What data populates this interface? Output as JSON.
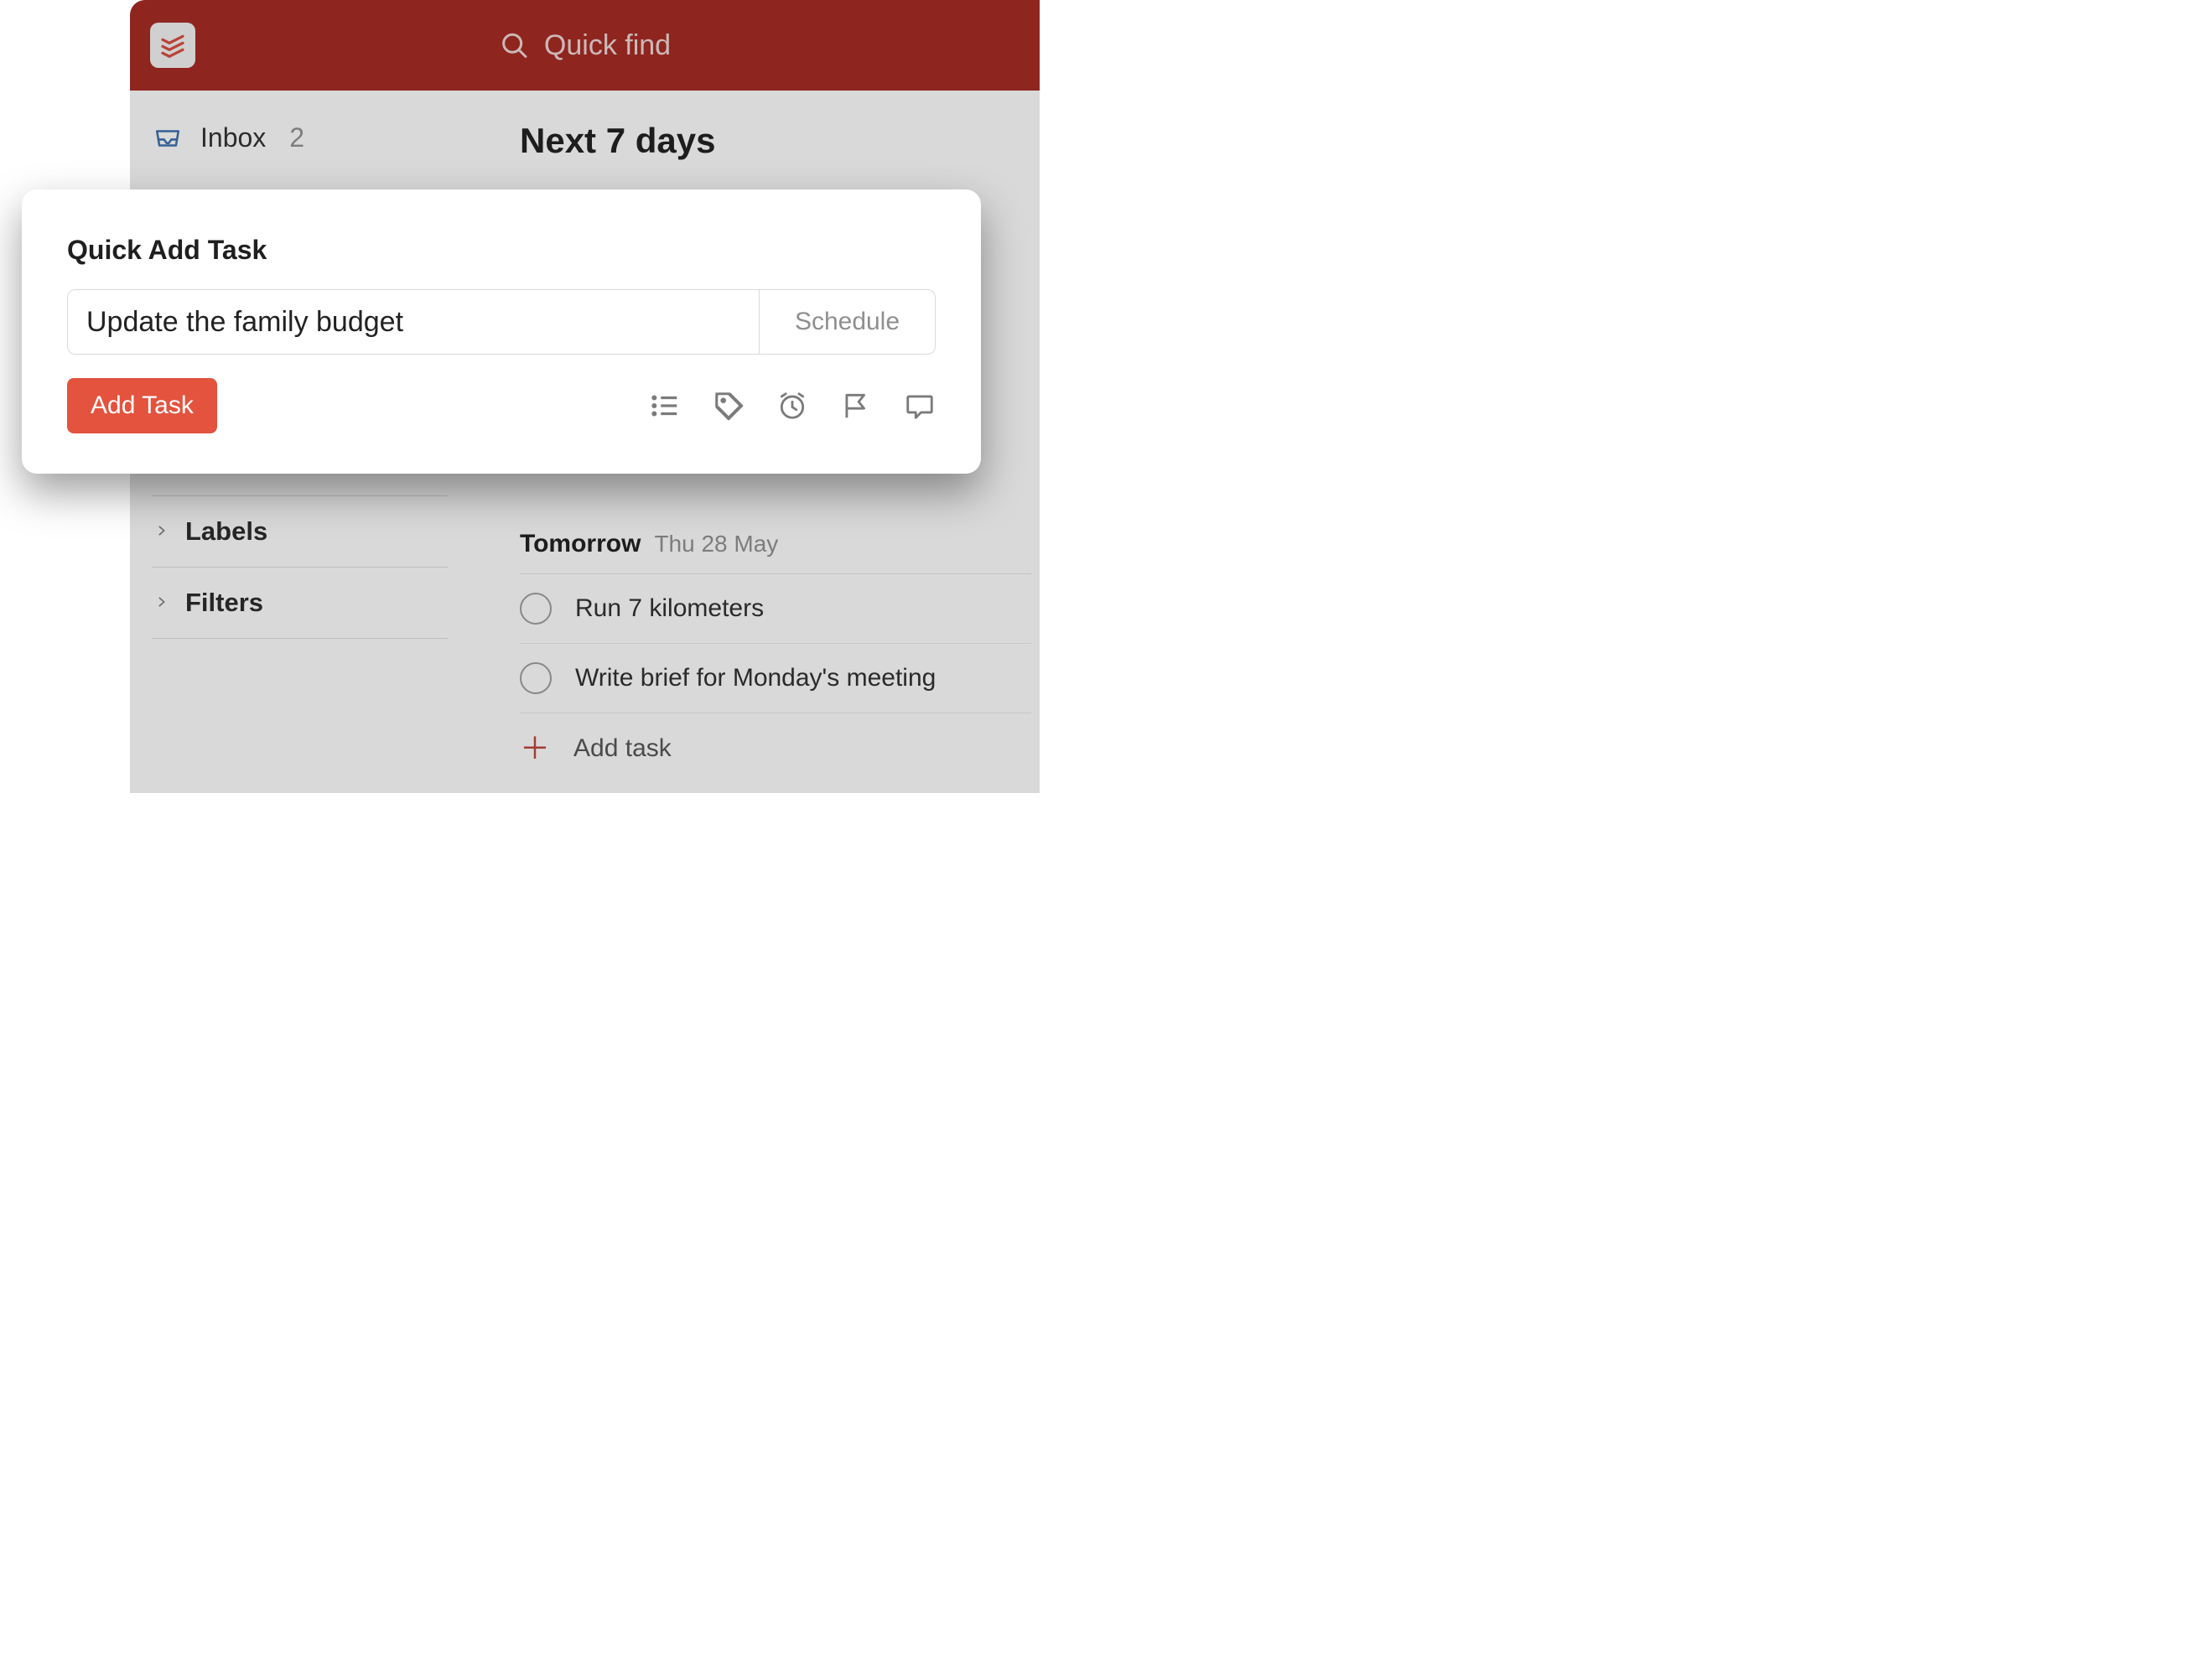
{
  "header": {
    "search_placeholder": "Quick find"
  },
  "sidebar": {
    "inbox_label": "Inbox",
    "inbox_count": "2",
    "sections": [
      {
        "label": "Labels"
      },
      {
        "label": "Filters"
      }
    ]
  },
  "main": {
    "title": "Next 7 days",
    "groups": [
      {
        "name": "Tomorrow",
        "date": "Thu 28 May",
        "tasks": [
          {
            "title": "Run 7 kilometers"
          },
          {
            "title": "Write brief for Monday's meeting"
          }
        ],
        "add_label": "Add task"
      }
    ]
  },
  "modal": {
    "title": "Quick Add Task",
    "task_value": "Update the family budget",
    "schedule_label": "Schedule",
    "add_button": "Add Task",
    "icons": [
      "project-icon",
      "label-icon",
      "reminder-icon",
      "priority-icon",
      "comment-icon"
    ]
  }
}
